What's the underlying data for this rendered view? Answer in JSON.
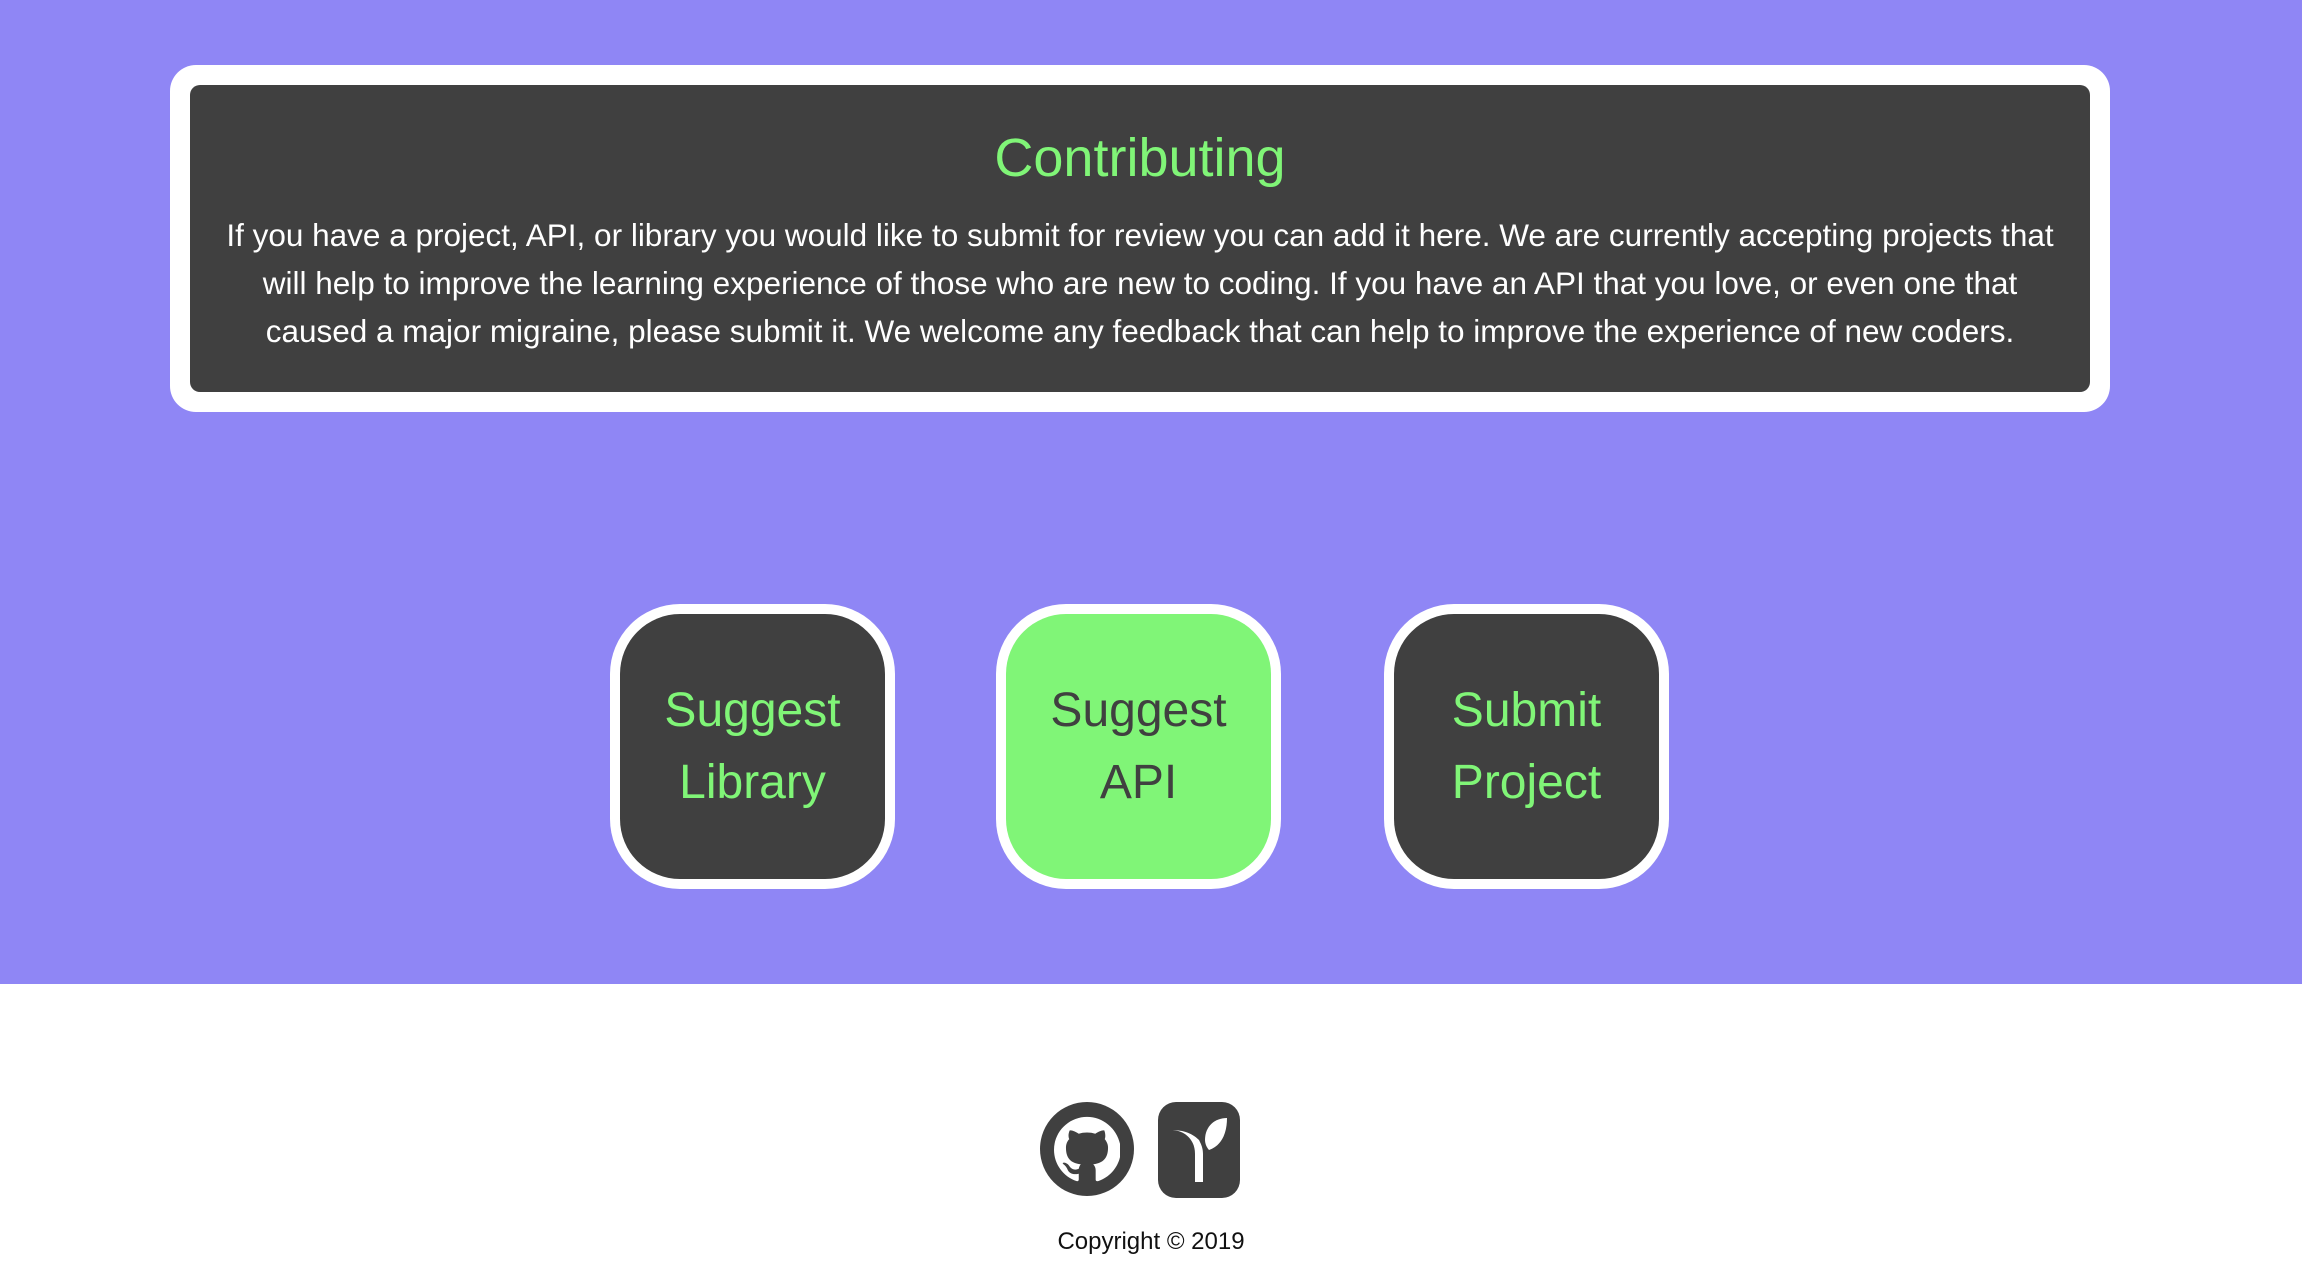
{
  "colors": {
    "background": "#8f86f5",
    "panel": "#404040",
    "accent": "#80f577",
    "white": "#ffffff"
  },
  "contributing": {
    "title": "Contributing",
    "body": "If you have a project, API, or library you would like to submit for review you can add it here. We are currently accepting projects that will help to improve the learning experience of those who are new to coding. If you have an API that you love, or even one that caused a major migraine, please submit it. We welcome any feedback that can help to improve the experience of new coders."
  },
  "buttons": [
    {
      "label": "Suggest Library"
    },
    {
      "label": "Suggest API"
    },
    {
      "label": "Submit Project"
    }
  ],
  "footer": {
    "icons": [
      "github-icon",
      "sprout-icon"
    ],
    "copyright": "Copyright © 2019"
  }
}
